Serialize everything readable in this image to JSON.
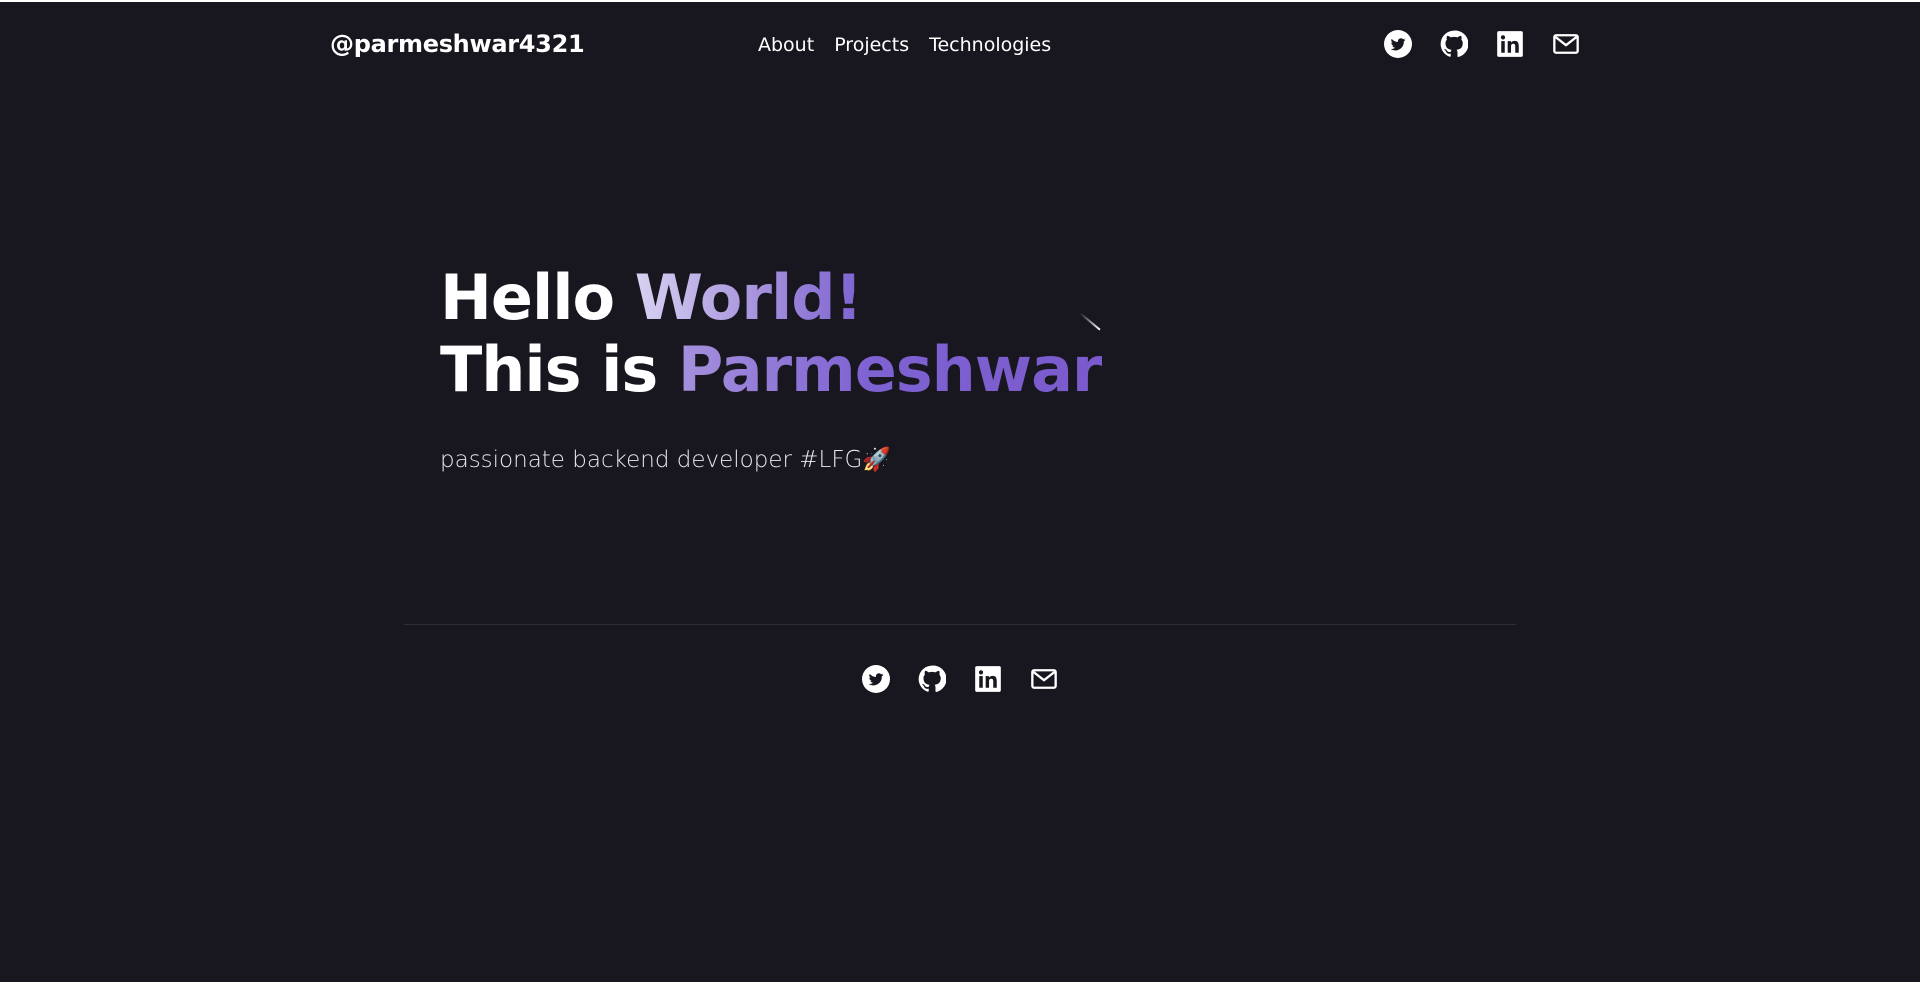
{
  "header": {
    "brand": "@parmeshwar4321",
    "nav": [
      {
        "label": "About"
      },
      {
        "label": "Projects"
      },
      {
        "label": "Technologies"
      }
    ],
    "social_icons": [
      "twitter-icon",
      "github-icon",
      "linkedin-icon",
      "mail-icon"
    ]
  },
  "hero": {
    "line1_plain": "Hello ",
    "line1_accent": "World!",
    "line2_plain": "This is ",
    "line2_accent": "Parmeshwar",
    "tagline": "passionate backend developer #LFG🚀"
  },
  "footer": {
    "social_icons": [
      "twitter-icon",
      "github-icon",
      "linkedin-icon",
      "mail-icon"
    ]
  },
  "colors": {
    "background": "#18171f",
    "text": "#ffffff",
    "accent_light": "#d9d2f2",
    "accent_dark": "#7a5acc",
    "divider": "#2e2d37"
  }
}
